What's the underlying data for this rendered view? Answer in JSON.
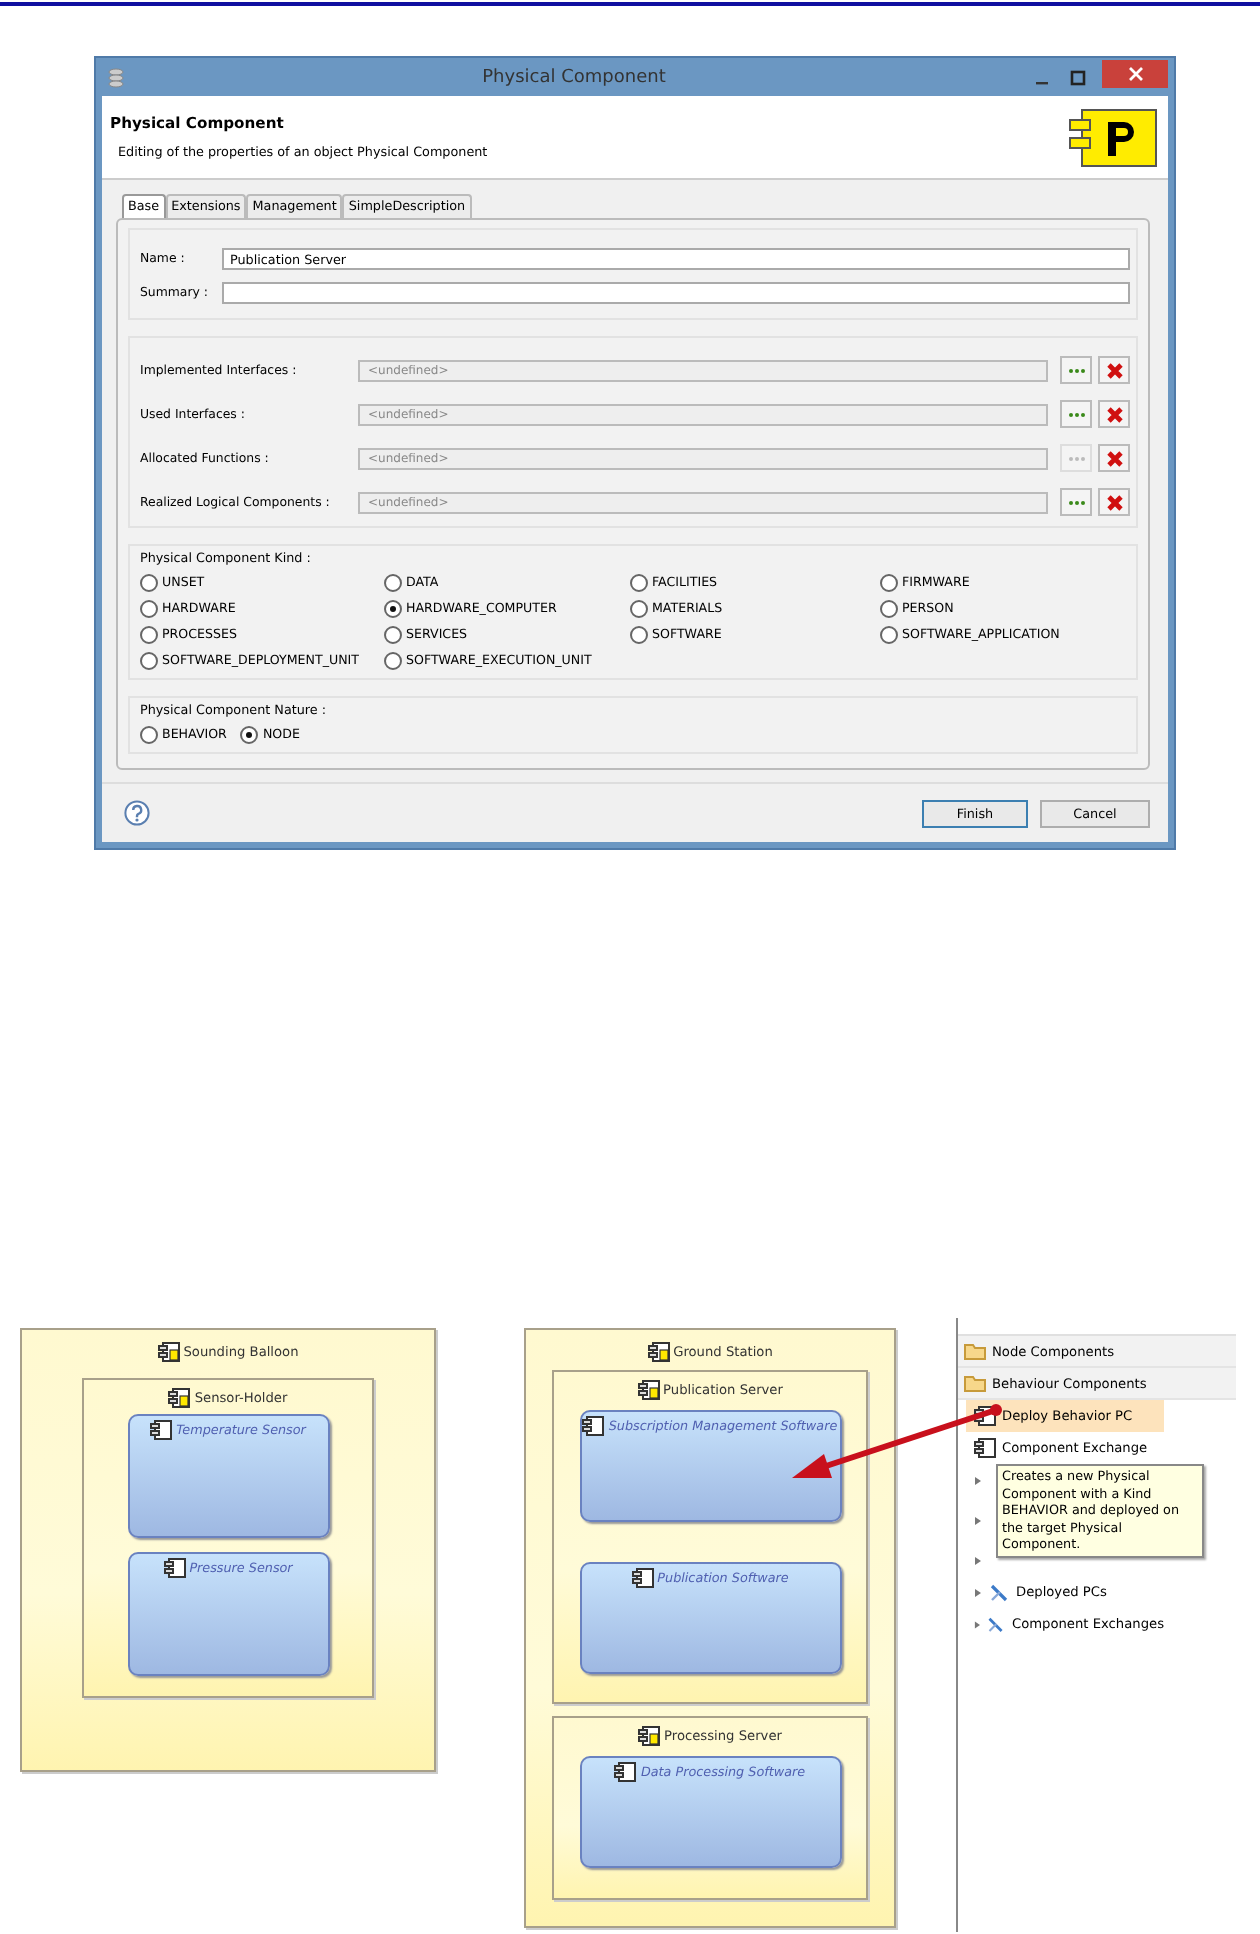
{
  "dialog": {
    "title": "Physical Component",
    "header": {
      "title": "Physical Component",
      "description": "Editing of the properties of an object Physical Component"
    },
    "tabs": [
      {
        "label": "Base",
        "selected": true
      },
      {
        "label": "Extensions",
        "selected": false
      },
      {
        "label": "Management",
        "selected": false
      },
      {
        "label": "SimpleDescription",
        "selected": false
      }
    ],
    "name": {
      "label": "Name :",
      "value": "Publication Server"
    },
    "summary": {
      "label": "Summary :"
    },
    "references": [
      {
        "label": "Implemented Interfaces :",
        "placeholder": "<undefined>",
        "browse_enabled": true
      },
      {
        "label": "Used Interfaces :",
        "placeholder": "<undefined>",
        "browse_enabled": true
      },
      {
        "label": "Allocated Functions :",
        "placeholder": "<undefined>",
        "browse_enabled": false
      },
      {
        "label": "Realized Logical Components :",
        "placeholder": "<undefined>",
        "browse_enabled": true
      }
    ],
    "kind_group": {
      "title": "Physical Component Kind :",
      "options": [
        {
          "label": "UNSET",
          "selected": false
        },
        {
          "label": "DATA",
          "selected": false
        },
        {
          "label": "FACILITIES",
          "selected": false
        },
        {
          "label": "FIRMWARE",
          "selected": false
        },
        {
          "label": "HARDWARE",
          "selected": false
        },
        {
          "label": "HARDWARE_COMPUTER",
          "selected": true
        },
        {
          "label": "MATERIALS",
          "selected": false
        },
        {
          "label": "PERSON",
          "selected": false
        },
        {
          "label": "PROCESSES",
          "selected": false
        },
        {
          "label": "SERVICES",
          "selected": false
        },
        {
          "label": "SOFTWARE",
          "selected": false
        },
        {
          "label": "SOFTWARE_APPLICATION",
          "selected": false
        },
        {
          "label": "SOFTWARE_DEPLOYMENT_UNIT",
          "selected": false
        },
        {
          "label": "SOFTWARE_EXECUTION_UNIT",
          "selected": false
        }
      ]
    },
    "nature_group": {
      "title": "Physical Component Nature :",
      "options": [
        {
          "label": "BEHAVIOR",
          "selected": false
        },
        {
          "label": "NODE",
          "selected": true
        }
      ]
    },
    "buttons": [
      {
        "label": "Finish",
        "default": true
      },
      {
        "label": "Cancel",
        "default": false
      }
    ]
  },
  "diagram": {
    "nodes": [
      {
        "title": "Sounding Balloon",
        "kind": "node",
        "children": [
          {
            "title": "Sensor-Holder",
            "kind": "node",
            "children": [
              {
                "title": "Temperature Sensor",
                "kind": "behavior"
              },
              {
                "title": "Pressure Sensor",
                "kind": "behavior"
              }
            ]
          }
        ]
      },
      {
        "title": "Ground Station",
        "kind": "node",
        "children": [
          {
            "title": "Publication Server",
            "kind": "node",
            "children": [
              {
                "title": "Subscription Management Software",
                "kind": "behavior"
              },
              {
                "title": "Publication Software",
                "kind": "behavior"
              }
            ]
          },
          {
            "title": "Processing Server",
            "kind": "node",
            "children": [
              {
                "title": "Data Processing Software",
                "kind": "behavior"
              }
            ]
          }
        ]
      }
    ]
  },
  "palette": {
    "sections": [
      {
        "label": "Node Components"
      },
      {
        "label": "Behaviour Components"
      }
    ],
    "items": [
      {
        "kind": "tool",
        "label": "Deploy Behavior PC",
        "selected": true
      },
      {
        "kind": "tool",
        "label": "Component Exchange",
        "selected": false
      },
      {
        "kind": "covered"
      },
      {
        "kind": "covered"
      },
      {
        "kind": "covered"
      },
      {
        "kind": "drawer",
        "label": "Deployed PCs",
        "selected": false
      },
      {
        "kind": "drawer",
        "label": "Component Exchanges",
        "selected": false
      }
    ],
    "tooltip": "Creates a new Physical Component with a Kind BEHAVIOR and deployed on the target Physical Component."
  }
}
